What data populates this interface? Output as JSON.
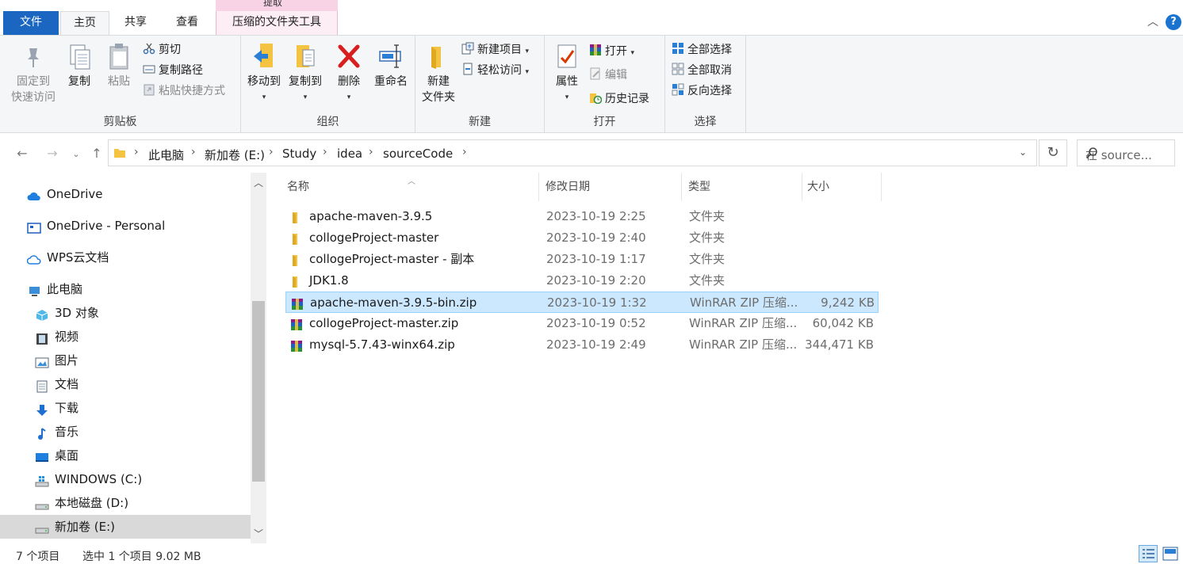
{
  "ribbon_tabs": {
    "file": "文件",
    "home": "主页",
    "share": "共享",
    "view": "查看",
    "context_header": "提取",
    "zip_tools": "压缩的文件夹工具"
  },
  "ribbon": {
    "clipboard": {
      "pin_line1": "固定到",
      "pin_line2": "快速访问",
      "copy": "复制",
      "paste": "粘贴",
      "cut": "剪切",
      "copy_path": "复制路径",
      "paste_shortcut": "粘贴快捷方式",
      "label": "剪贴板"
    },
    "organize": {
      "move_to": "移动到",
      "copy_to": "复制到",
      "delete": "删除",
      "rename": "重命名",
      "label": "组织"
    },
    "new": {
      "new_folder_line1": "新建",
      "new_folder_line2": "文件夹",
      "new_item": "新建项目",
      "easy_access": "轻松访问",
      "label": "新建"
    },
    "open": {
      "properties": "属性",
      "open": "打开",
      "edit": "编辑",
      "history": "历史记录",
      "label": "打开"
    },
    "select": {
      "select_all": "全部选择",
      "select_none": "全部取消",
      "invert": "反向选择",
      "label": "选择"
    }
  },
  "address": {
    "crumbs": [
      "此电脑",
      "新加卷 (E:)",
      "Study",
      "idea",
      "sourceCode"
    ],
    "search_placeholder": "在 source..."
  },
  "nav_pane": {
    "items": [
      {
        "label": "OneDrive",
        "icon": "cloud-icon"
      },
      {
        "label": "OneDrive - Personal",
        "icon": "onedrive-personal-icon"
      },
      {
        "label": "WPS云文档",
        "icon": "wps-cloud-icon"
      },
      {
        "label": "此电脑",
        "icon": "computer-icon"
      },
      {
        "label": "3D 对象",
        "icon": "3d-objects-icon"
      },
      {
        "label": "视频",
        "icon": "video-icon"
      },
      {
        "label": "图片",
        "icon": "pictures-icon"
      },
      {
        "label": "文档",
        "icon": "documents-icon"
      },
      {
        "label": "下载",
        "icon": "download-icon"
      },
      {
        "label": "音乐",
        "icon": "music-icon"
      },
      {
        "label": "桌面",
        "icon": "desktop-icon"
      },
      {
        "label": "WINDOWS (C:)",
        "icon": "windows-drive-icon"
      },
      {
        "label": "本地磁盘 (D:)",
        "icon": "drive-icon"
      },
      {
        "label": "新加卷 (E:)",
        "icon": "drive-icon"
      }
    ],
    "selected_index": 13
  },
  "columns": {
    "name": "名称",
    "date": "修改日期",
    "type": "类型",
    "size": "大小"
  },
  "files": [
    {
      "name": "apache-maven-3.9.5",
      "date": "2023-10-19 2:25",
      "type": "文件夹",
      "size": "",
      "kind": "folder"
    },
    {
      "name": "collogeProject-master",
      "date": "2023-10-19 2:40",
      "type": "文件夹",
      "size": "",
      "kind": "folder"
    },
    {
      "name": "collogeProject-master - 副本",
      "date": "2023-10-19 1:17",
      "type": "文件夹",
      "size": "",
      "kind": "folder"
    },
    {
      "name": "JDK1.8",
      "date": "2023-10-19 2:20",
      "type": "文件夹",
      "size": "",
      "kind": "folder"
    },
    {
      "name": "apache-maven-3.9.5-bin.zip",
      "date": "2023-10-19 1:32",
      "type": "WinRAR ZIP 压缩...",
      "size": "9,242 KB",
      "kind": "zip"
    },
    {
      "name": "collogeProject-master.zip",
      "date": "2023-10-19 0:52",
      "type": "WinRAR ZIP 压缩...",
      "size": "60,042 KB",
      "kind": "zip"
    },
    {
      "name": "mysql-5.7.43-winx64.zip",
      "date": "2023-10-19 2:49",
      "type": "WinRAR ZIP 压缩...",
      "size": "344,471 KB",
      "kind": "zip"
    }
  ],
  "selected_file_index": 4,
  "status": {
    "count": "7 个项目",
    "selection": "选中 1 个项目  9.02 MB"
  },
  "colors": {
    "file_tab": "#1a66c0",
    "selection": "#cce8ff",
    "context_tab": "#f8d2e5",
    "folder": "#f5c342"
  }
}
